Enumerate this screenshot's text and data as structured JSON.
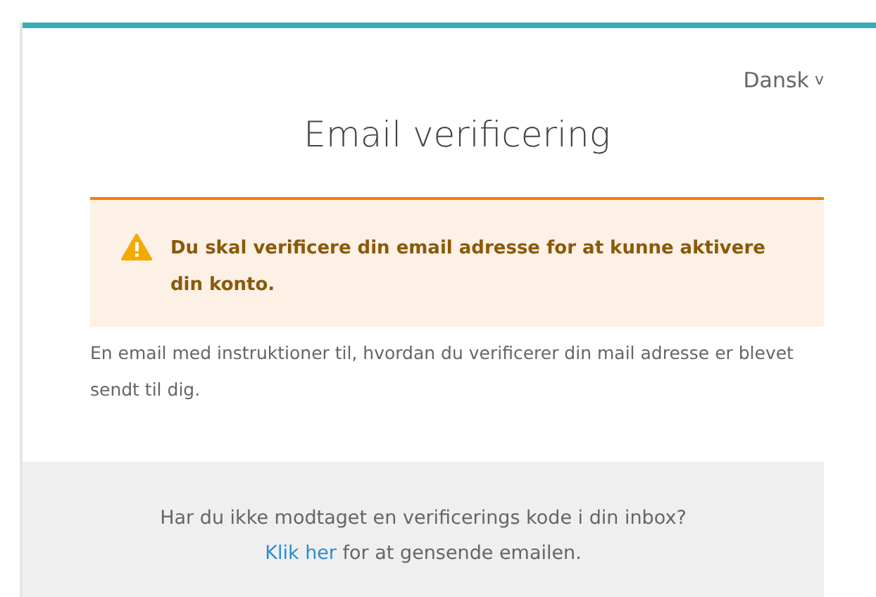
{
  "language_selector": {
    "label": "Dansk",
    "caret": "v"
  },
  "title": "Email verificering",
  "alert": {
    "kind": "warning",
    "message": "Du skal verificere din email adresse for at kunne aktivere din konto."
  },
  "info_text": "En email med instruktioner til, hvordan du verificerer din mail adresse er blevet sendt til dig.",
  "footer": {
    "question": "Har du ikke modtaget en verificerings kode i din inbox?",
    "link": "Klik her",
    "rest": " for at gensende emailen."
  }
}
